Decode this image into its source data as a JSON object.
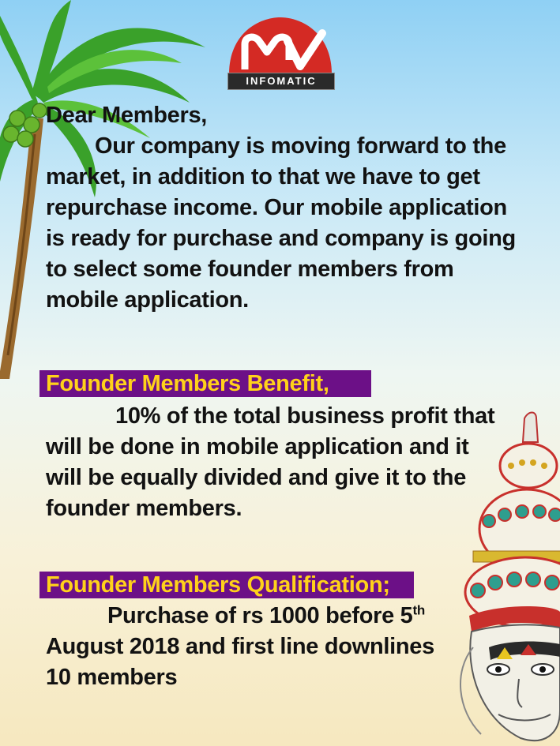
{
  "logo": {
    "brand_letters": "MV",
    "brand_text": "INFOMATIC",
    "colors": {
      "mark": "#d42a24",
      "label_bg": "#2a2a2a"
    }
  },
  "letter": {
    "greeting": "Dear Members,",
    "intro_lines": [
      "Our company is moving forward to the",
      "market,  in addition  to  that we have to get",
      "repurchase income. Our mobile application",
      "is ready for purchase and company is going",
      "to select some founder members from",
      "mobile application."
    ]
  },
  "benefit": {
    "heading": "Founder Members Benefit,",
    "lines": [
      "10% of the total business profit that",
      "will  be done  in mobile  application  and it",
      "will be equally divided and give it to the",
      "founder members."
    ]
  },
  "qualification": {
    "heading": "Founder Members Qualification;",
    "line1": "Purchase of rs 1000 before 5",
    "line1_sup": "th",
    "lines": [
      "August 2018 and first line downlines",
      "10 members"
    ]
  },
  "colors": {
    "banner_bg": "#6c1087",
    "banner_text": "#ffd21a",
    "body_text": "#121212"
  }
}
